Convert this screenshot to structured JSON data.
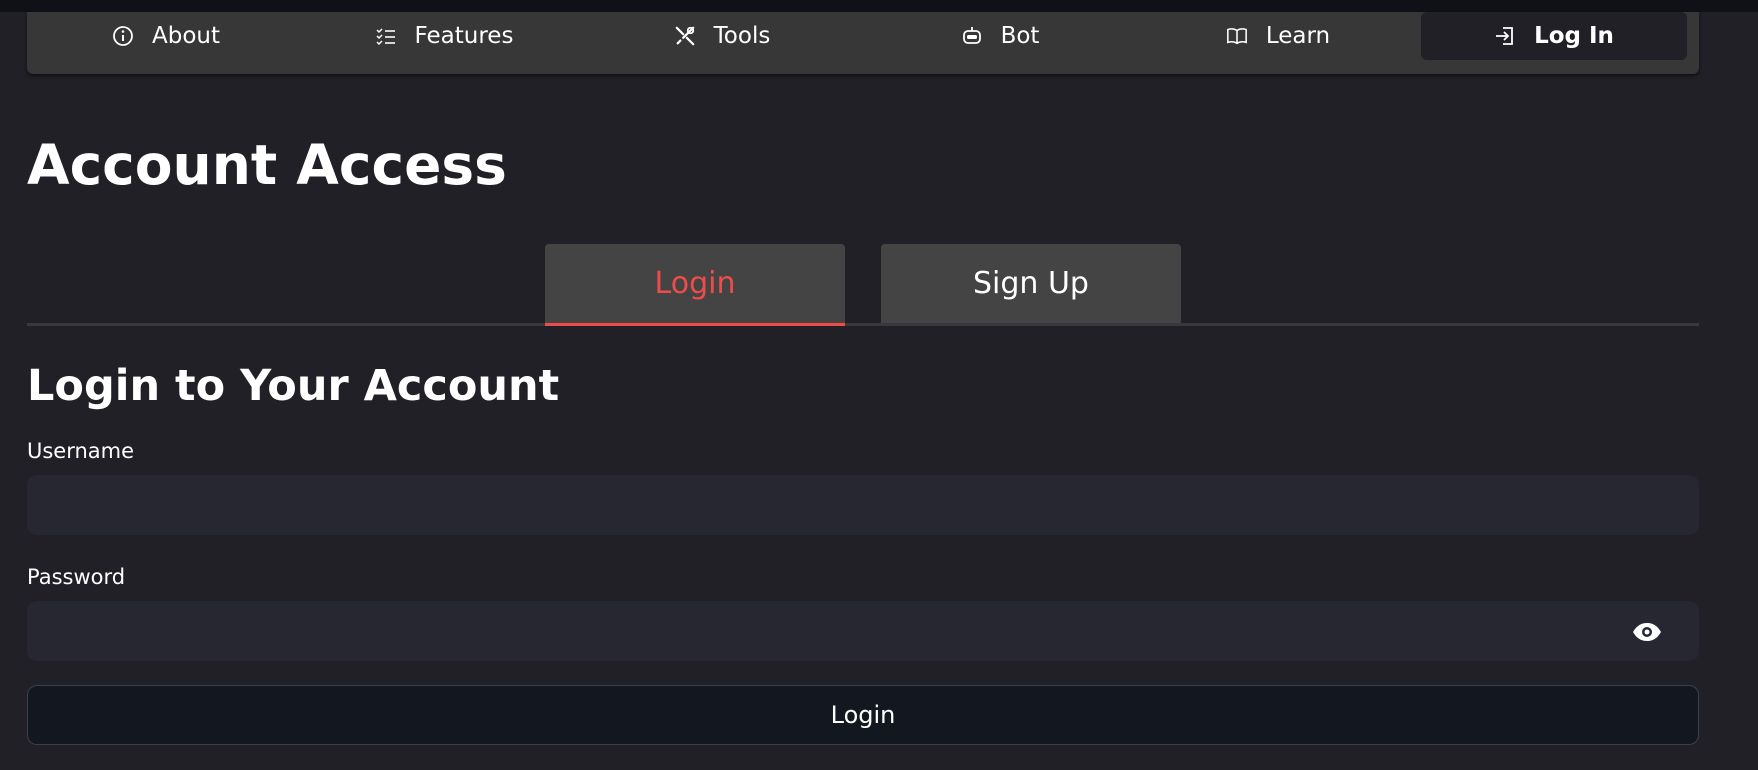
{
  "nav": {
    "items": [
      {
        "label": "About",
        "icon": "info-icon"
      },
      {
        "label": "Features",
        "icon": "list-icon"
      },
      {
        "label": "Tools",
        "icon": "tools-icon"
      },
      {
        "label": "Bot",
        "icon": "robot-icon"
      },
      {
        "label": "Learn",
        "icon": "book-icon"
      },
      {
        "label": "Log In",
        "icon": "login-icon",
        "active": true
      }
    ]
  },
  "page": {
    "title": "Account Access"
  },
  "tabs": [
    {
      "label": "Login",
      "active": true
    },
    {
      "label": "Sign Up",
      "active": false
    }
  ],
  "form": {
    "title": "Login to Your Account",
    "username_label": "Username",
    "username_value": "",
    "password_label": "Password",
    "password_value": "",
    "submit_label": "Login"
  },
  "colors": {
    "background": "#202026",
    "navbar": "#373737",
    "accent": "#ef4b4b",
    "input_bg": "#262730",
    "button_bg": "#131720"
  }
}
